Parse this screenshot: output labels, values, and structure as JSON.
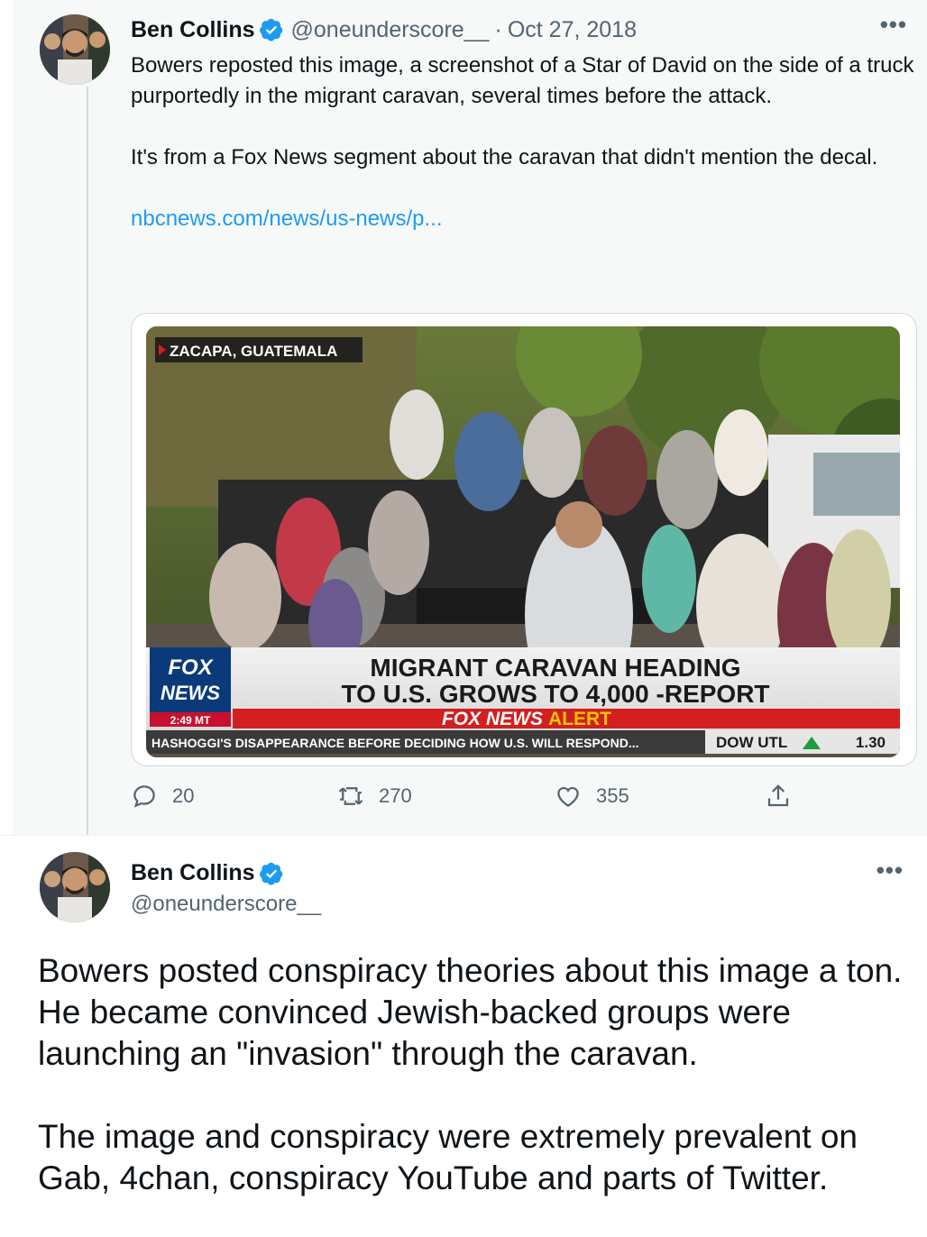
{
  "tweet1": {
    "author_name": "Ben Collins",
    "handle": "@oneunderscore__",
    "separator": "·",
    "date": "Oct 27, 2018",
    "more": "•••",
    "paragraph1": "Bowers reposted this image, a screenshot of a Star of David on the side of a truck purportedly in the migrant caravan, several times before the attack.",
    "paragraph2": "It's from a Fox News segment about the caravan that didn't mention the decal.",
    "link": "nbcnews.com/news/us-news/p...",
    "media": {
      "location": "ZACAPA, GUATEMALA",
      "logo_line1": "FOX",
      "logo_line2": "NEWS",
      "time": "2:49 MT",
      "headline_line1": "MIGRANT CARAVAN HEADING",
      "headline_line2": "TO U.S. GROWS TO 4,000 -REPORT",
      "alert_fox": "FOX NEWS",
      "alert_word": "ALERT",
      "ticker": "HASHOGGI'S DISAPPEARANCE BEFORE DECIDING HOW U.S. WILL RESPOND...",
      "ticker_label": "DOW UTL",
      "ticker_value": "1.30"
    },
    "actions": {
      "replies": "20",
      "retweets": "270",
      "likes": "355"
    }
  },
  "tweet2": {
    "author_name": "Ben Collins",
    "handle": "@oneunderscore__",
    "more": "•••",
    "paragraph1": "Bowers posted conspiracy theories about this image a ton. He became convinced Jewish-backed groups were launching an \"invasion\" through the caravan.",
    "paragraph2": "The image and conspiracy were extremely prevalent on Gab, 4chan, conspiracy YouTube and parts of Twitter."
  },
  "colors": {
    "accent": "#1d9bf0",
    "muted": "#536471",
    "text": "#0f1419",
    "highlight_bg": "#f7f9f9",
    "fox_alert_red": "#d21f1f",
    "fox_alert_yellow": "#f5c400"
  }
}
